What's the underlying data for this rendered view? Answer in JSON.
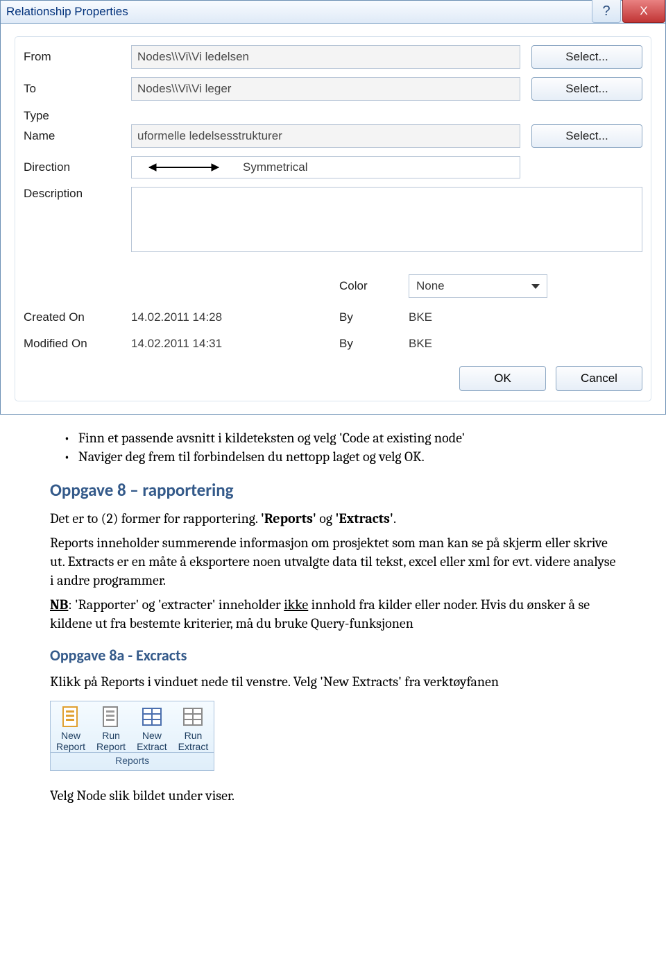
{
  "dialog": {
    "title": "Relationship Properties",
    "help_symbol": "?",
    "close_symbol": "X",
    "labels": {
      "from": "From",
      "to": "To",
      "type": "Type",
      "name": "Name",
      "direction": "Direction",
      "description": "Description",
      "color": "Color",
      "created_on": "Created On",
      "modified_on": "Modified On",
      "by": "By"
    },
    "values": {
      "from": "Nodes\\\\Vi\\Vi ledelsen",
      "to": "Nodes\\\\Vi\\Vi leger",
      "name": "uformelle ledelsesstrukturer",
      "direction": "Symmetrical",
      "description": "",
      "color": "None",
      "created_on": "14.02.2011 14:28",
      "created_by": "BKE",
      "modified_on": "14.02.2011 14:31",
      "modified_by": "BKE"
    },
    "buttons": {
      "select": "Select...",
      "ok": "OK",
      "cancel": "Cancel"
    }
  },
  "doc": {
    "bullets": [
      "Finn et passende avsnitt i kildeteksten og velg 'Code at existing node'",
      "Naviger deg frem til forbindelsen du nettopp laget og velg OK."
    ],
    "h_rapportering": "Oppgave 8 – rapportering",
    "para1_pre": "Det er to (2) former for rapportering. ",
    "para1_bold": "'Reports'",
    "para1_mid": " og ",
    "para1_bold2": "'Extracts'",
    "para1_post": ".",
    "para2": "Reports inneholder summerende informasjon om prosjektet som man kan se på skjerm eller skrive ut. Extracts er en måte å eksportere  noen utvalgte data til tekst, excel eller xml for evt. videre analyse i andre programmer.",
    "nb_label": "NB",
    "nb_text": ": 'Rapporter' og 'extracter' inneholder ",
    "nb_underline": "ikke",
    "nb_text2": " innhold fra kilder eller noder. Hvis du ønsker å se kildene ut fra bestemte kriterier, må du bruke Query-funksjonen",
    "h_extracts": "Oppgave 8a - Excracts",
    "para3": "Klikk på Reports i vinduet nede til venstre. Velg 'New Extracts' fra verktøyfanen",
    "para4": "Velg Node slik bildet under viser."
  },
  "ribbon": {
    "items": [
      {
        "l1": "New",
        "l2": "Report"
      },
      {
        "l1": "Run",
        "l2": "Report"
      },
      {
        "l1": "New",
        "l2": "Extract"
      },
      {
        "l1": "Run",
        "l2": "Extract"
      }
    ],
    "group": "Reports"
  }
}
